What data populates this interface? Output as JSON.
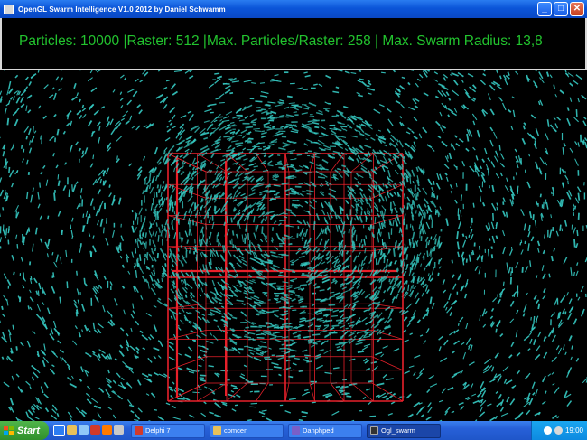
{
  "window": {
    "title": "OpenGL Swarm Intelligence V1.0 2012 by Daniel Schwamm",
    "minimize_icon": "minimize-icon",
    "maximize_icon": "maximize-icon",
    "close_icon": "close-icon"
  },
  "hud": {
    "text": "Particles: 10000 |Raster: 512 |Max. Particles/Raster: 258 | Max. Swarm Radius: 13,8",
    "color": "#22c32e"
  },
  "scene": {
    "particle_color": "#35c9c2",
    "grid_color": "#e8202a",
    "particles": 10000,
    "raster": 512,
    "max_particles_per_raster": 258,
    "max_swarm_radius": 13.8
  },
  "taskbar": {
    "start_label": "Start",
    "tasks": [
      {
        "label": "Delphi 7",
        "icon": "delphi-icon",
        "active": false
      },
      {
        "label": "comcen",
        "icon": "folder-icon",
        "active": false
      },
      {
        "label": "Danphped",
        "icon": "editor-icon",
        "active": false
      },
      {
        "label": "Ogl_swarm",
        "icon": "app-icon",
        "active": true
      }
    ],
    "clock": "19:00"
  }
}
